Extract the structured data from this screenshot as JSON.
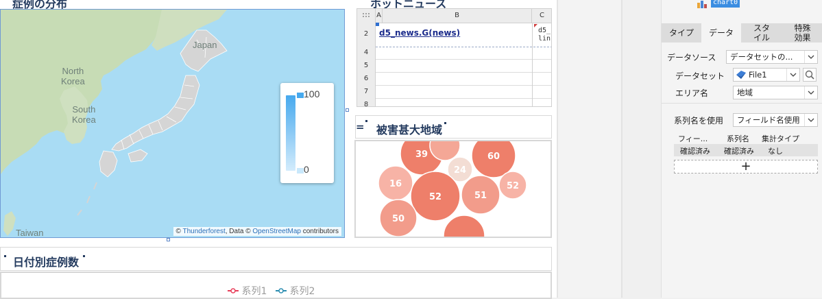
{
  "map": {
    "title": "症例の分布",
    "labels": {
      "japan": "Japan",
      "north_korea": "North\nKorea",
      "south_korea": "South\nKorea",
      "taiwan": "Taiwan"
    },
    "legend_max": "100",
    "legend_min": "0",
    "attribution": {
      "prefix": "© ",
      "provider": "Thunderforest",
      "mid": ", Data © ",
      "osm": "OpenStreetMap",
      "suffix": " contributors"
    }
  },
  "sheet": {
    "title": "ホットニュース",
    "columns": [
      "A",
      "B",
      "C"
    ],
    "rows": [
      "2",
      "4",
      "5",
      "6",
      "7",
      "8"
    ],
    "cell_b2": "d5_news.G(news)",
    "cell_c2": "d5_\nlin"
  },
  "bubble": {
    "title_prefix": "=",
    "title": "被害甚大地域",
    "values": [
      39,
      60,
      24,
      16,
      52,
      51,
      52,
      50
    ]
  },
  "date_chart": {
    "title": "日付別症例数",
    "series": [
      {
        "name": "系列1",
        "color": "#e83e5a"
      },
      {
        "name": "系列2",
        "color": "#2a8cb0"
      }
    ]
  },
  "panel": {
    "chart_name": "chart0",
    "tabs": [
      "タイプ",
      "データ",
      "スタイル",
      "特殊効果"
    ],
    "active_tab": "データ",
    "datasource_label": "データソース",
    "datasource_value": "データセットの...",
    "dataset_label": "データセット",
    "dataset_value": "File1",
    "area_label": "エリア名",
    "area_value": "地域",
    "series_name_label": "系列名を使用",
    "series_name_value": "フィールド名使用",
    "field_headers": [
      "フィー...",
      "系列名",
      "集計タイプ"
    ],
    "field_row": [
      "確認済み",
      "確認済み",
      "なし"
    ],
    "add_label": "+"
  }
}
